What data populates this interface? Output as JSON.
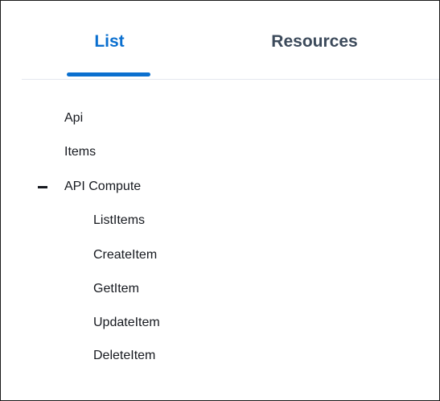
{
  "tabs": {
    "list_label": "List",
    "resources_label": "Resources",
    "active": "List"
  },
  "nav": {
    "items": [
      {
        "label": "Api"
      },
      {
        "label": "Items"
      }
    ],
    "group": {
      "label": "API Compute",
      "expanded": true,
      "toggle_icon": "collapse-minus-icon",
      "children": [
        {
          "label": "ListItems"
        },
        {
          "label": "CreateItem"
        },
        {
          "label": "GetItem"
        },
        {
          "label": "UpdateItem"
        },
        {
          "label": "DeleteItem"
        }
      ]
    }
  },
  "colors": {
    "accent": "#0a6fcf",
    "inactive_tab": "#3c4a5b",
    "text": "#16191f",
    "divider": "#e4e8ee"
  }
}
